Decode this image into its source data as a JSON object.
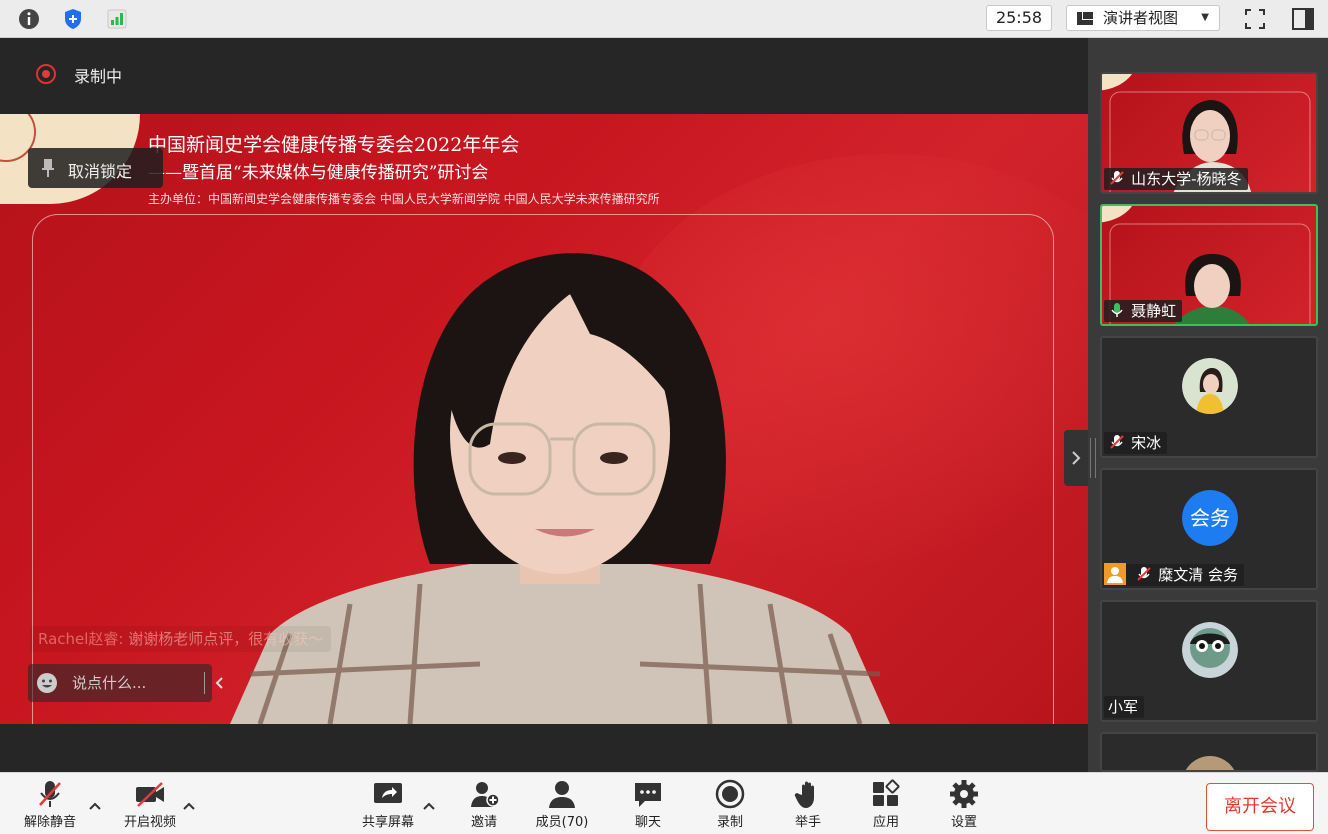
{
  "window": {
    "timer": "25:58",
    "view_select": "演讲者视图"
  },
  "main": {
    "recording_label": "录制中",
    "unpin_label": "取消锁定",
    "banner": {
      "title": "中国新闻史学会健康传播专委会2022年年会",
      "subtitle": "——暨首届“未来媒体与健康传播研究”研讨会",
      "host": "主办单位：中国新闻史学会健康传播专委会   中国人民大学新闻学院   中国人民大学未来传播研究所"
    },
    "chat": {
      "sender": "Rachel赵睿:",
      "message": "谢谢杨老师点评，很有收获～",
      "input_placeholder": "说点什么..."
    }
  },
  "participants": [
    {
      "name": "山东大学-杨晓冬",
      "muted": true,
      "type": "video"
    },
    {
      "name": "聂静虹",
      "muted": false,
      "type": "video",
      "speaking": true
    },
    {
      "name": "宋冰",
      "muted": true,
      "type": "avatar"
    },
    {
      "name": "糜文清 会务",
      "muted": true,
      "type": "avatar",
      "avatar_text": "会务",
      "avatar_color": "#1e7cf2",
      "is_host": true
    },
    {
      "name": "小军",
      "muted": false,
      "type": "avatar"
    }
  ],
  "toolbar": {
    "unmute": "解除静音",
    "start_video": "开启视频",
    "share_screen": "共享屏幕",
    "invite": "邀请",
    "members": "成员(70)",
    "chat": "聊天",
    "record": "录制",
    "raise_hand": "举手",
    "apps": "应用",
    "settings": "设置",
    "leave": "离开会议"
  },
  "colors": {
    "accent_red": "#e03a2e",
    "speaking_green": "#3fbf5a",
    "avatar_blue": "#1e7cf2"
  }
}
